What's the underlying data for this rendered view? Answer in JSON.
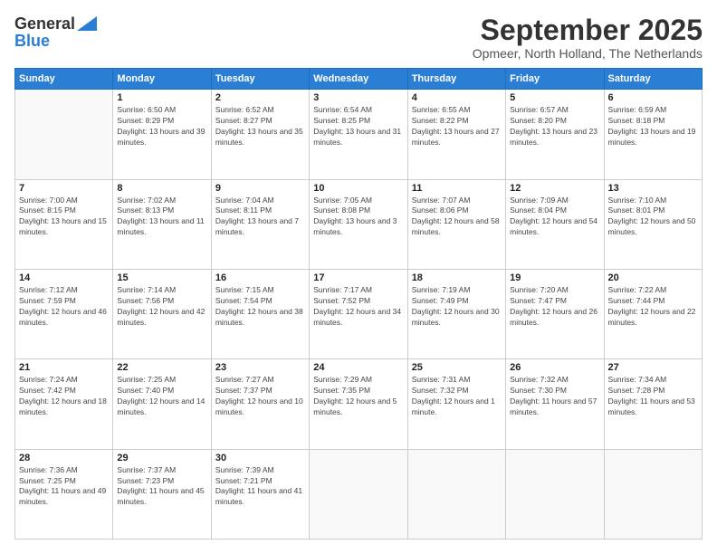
{
  "logo": {
    "general": "General",
    "blue": "Blue"
  },
  "title": "September 2025",
  "location": "Opmeer, North Holland, The Netherlands",
  "weekdays": [
    "Sunday",
    "Monday",
    "Tuesday",
    "Wednesday",
    "Thursday",
    "Friday",
    "Saturday"
  ],
  "weeks": [
    [
      {
        "day": "",
        "sunrise": "",
        "sunset": "",
        "daylight": ""
      },
      {
        "day": "1",
        "sunrise": "Sunrise: 6:50 AM",
        "sunset": "Sunset: 8:29 PM",
        "daylight": "Daylight: 13 hours and 39 minutes."
      },
      {
        "day": "2",
        "sunrise": "Sunrise: 6:52 AM",
        "sunset": "Sunset: 8:27 PM",
        "daylight": "Daylight: 13 hours and 35 minutes."
      },
      {
        "day": "3",
        "sunrise": "Sunrise: 6:54 AM",
        "sunset": "Sunset: 8:25 PM",
        "daylight": "Daylight: 13 hours and 31 minutes."
      },
      {
        "day": "4",
        "sunrise": "Sunrise: 6:55 AM",
        "sunset": "Sunset: 8:22 PM",
        "daylight": "Daylight: 13 hours and 27 minutes."
      },
      {
        "day": "5",
        "sunrise": "Sunrise: 6:57 AM",
        "sunset": "Sunset: 8:20 PM",
        "daylight": "Daylight: 13 hours and 23 minutes."
      },
      {
        "day": "6",
        "sunrise": "Sunrise: 6:59 AM",
        "sunset": "Sunset: 8:18 PM",
        "daylight": "Daylight: 13 hours and 19 minutes."
      }
    ],
    [
      {
        "day": "7",
        "sunrise": "Sunrise: 7:00 AM",
        "sunset": "Sunset: 8:15 PM",
        "daylight": "Daylight: 13 hours and 15 minutes."
      },
      {
        "day": "8",
        "sunrise": "Sunrise: 7:02 AM",
        "sunset": "Sunset: 8:13 PM",
        "daylight": "Daylight: 13 hours and 11 minutes."
      },
      {
        "day": "9",
        "sunrise": "Sunrise: 7:04 AM",
        "sunset": "Sunset: 8:11 PM",
        "daylight": "Daylight: 13 hours and 7 minutes."
      },
      {
        "day": "10",
        "sunrise": "Sunrise: 7:05 AM",
        "sunset": "Sunset: 8:08 PM",
        "daylight": "Daylight: 13 hours and 3 minutes."
      },
      {
        "day": "11",
        "sunrise": "Sunrise: 7:07 AM",
        "sunset": "Sunset: 8:06 PM",
        "daylight": "Daylight: 12 hours and 58 minutes."
      },
      {
        "day": "12",
        "sunrise": "Sunrise: 7:09 AM",
        "sunset": "Sunset: 8:04 PM",
        "daylight": "Daylight: 12 hours and 54 minutes."
      },
      {
        "day": "13",
        "sunrise": "Sunrise: 7:10 AM",
        "sunset": "Sunset: 8:01 PM",
        "daylight": "Daylight: 12 hours and 50 minutes."
      }
    ],
    [
      {
        "day": "14",
        "sunrise": "Sunrise: 7:12 AM",
        "sunset": "Sunset: 7:59 PM",
        "daylight": "Daylight: 12 hours and 46 minutes."
      },
      {
        "day": "15",
        "sunrise": "Sunrise: 7:14 AM",
        "sunset": "Sunset: 7:56 PM",
        "daylight": "Daylight: 12 hours and 42 minutes."
      },
      {
        "day": "16",
        "sunrise": "Sunrise: 7:15 AM",
        "sunset": "Sunset: 7:54 PM",
        "daylight": "Daylight: 12 hours and 38 minutes."
      },
      {
        "day": "17",
        "sunrise": "Sunrise: 7:17 AM",
        "sunset": "Sunset: 7:52 PM",
        "daylight": "Daylight: 12 hours and 34 minutes."
      },
      {
        "day": "18",
        "sunrise": "Sunrise: 7:19 AM",
        "sunset": "Sunset: 7:49 PM",
        "daylight": "Daylight: 12 hours and 30 minutes."
      },
      {
        "day": "19",
        "sunrise": "Sunrise: 7:20 AM",
        "sunset": "Sunset: 7:47 PM",
        "daylight": "Daylight: 12 hours and 26 minutes."
      },
      {
        "day": "20",
        "sunrise": "Sunrise: 7:22 AM",
        "sunset": "Sunset: 7:44 PM",
        "daylight": "Daylight: 12 hours and 22 minutes."
      }
    ],
    [
      {
        "day": "21",
        "sunrise": "Sunrise: 7:24 AM",
        "sunset": "Sunset: 7:42 PM",
        "daylight": "Daylight: 12 hours and 18 minutes."
      },
      {
        "day": "22",
        "sunrise": "Sunrise: 7:25 AM",
        "sunset": "Sunset: 7:40 PM",
        "daylight": "Daylight: 12 hours and 14 minutes."
      },
      {
        "day": "23",
        "sunrise": "Sunrise: 7:27 AM",
        "sunset": "Sunset: 7:37 PM",
        "daylight": "Daylight: 12 hours and 10 minutes."
      },
      {
        "day": "24",
        "sunrise": "Sunrise: 7:29 AM",
        "sunset": "Sunset: 7:35 PM",
        "daylight": "Daylight: 12 hours and 5 minutes."
      },
      {
        "day": "25",
        "sunrise": "Sunrise: 7:31 AM",
        "sunset": "Sunset: 7:32 PM",
        "daylight": "Daylight: 12 hours and 1 minute."
      },
      {
        "day": "26",
        "sunrise": "Sunrise: 7:32 AM",
        "sunset": "Sunset: 7:30 PM",
        "daylight": "Daylight: 11 hours and 57 minutes."
      },
      {
        "day": "27",
        "sunrise": "Sunrise: 7:34 AM",
        "sunset": "Sunset: 7:28 PM",
        "daylight": "Daylight: 11 hours and 53 minutes."
      }
    ],
    [
      {
        "day": "28",
        "sunrise": "Sunrise: 7:36 AM",
        "sunset": "Sunset: 7:25 PM",
        "daylight": "Daylight: 11 hours and 49 minutes."
      },
      {
        "day": "29",
        "sunrise": "Sunrise: 7:37 AM",
        "sunset": "Sunset: 7:23 PM",
        "daylight": "Daylight: 11 hours and 45 minutes."
      },
      {
        "day": "30",
        "sunrise": "Sunrise: 7:39 AM",
        "sunset": "Sunset: 7:21 PM",
        "daylight": "Daylight: 11 hours and 41 minutes."
      },
      {
        "day": "",
        "sunrise": "",
        "sunset": "",
        "daylight": ""
      },
      {
        "day": "",
        "sunrise": "",
        "sunset": "",
        "daylight": ""
      },
      {
        "day": "",
        "sunrise": "",
        "sunset": "",
        "daylight": ""
      },
      {
        "day": "",
        "sunrise": "",
        "sunset": "",
        "daylight": ""
      }
    ]
  ]
}
